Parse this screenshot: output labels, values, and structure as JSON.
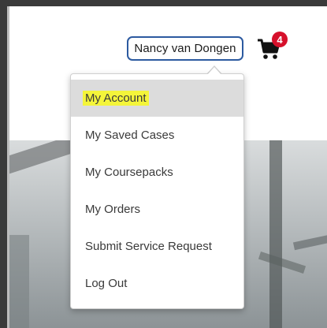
{
  "header": {
    "user_name": "Nancy van Dongen",
    "cart": {
      "icon": "cart-icon",
      "badge_count": "4",
      "badge_color": "#d6102b"
    }
  },
  "menu": {
    "items": [
      {
        "label": "My Account",
        "active": true
      },
      {
        "label": "My Saved Cases"
      },
      {
        "label": "My Coursepacks"
      },
      {
        "label": "My Orders"
      },
      {
        "label": "Submit Service Request"
      },
      {
        "label": "Log Out"
      }
    ]
  },
  "colors": {
    "pill_border": "#2c5aa0",
    "highlight": "#f4f53a",
    "active_bg": "#dcdcdc"
  }
}
